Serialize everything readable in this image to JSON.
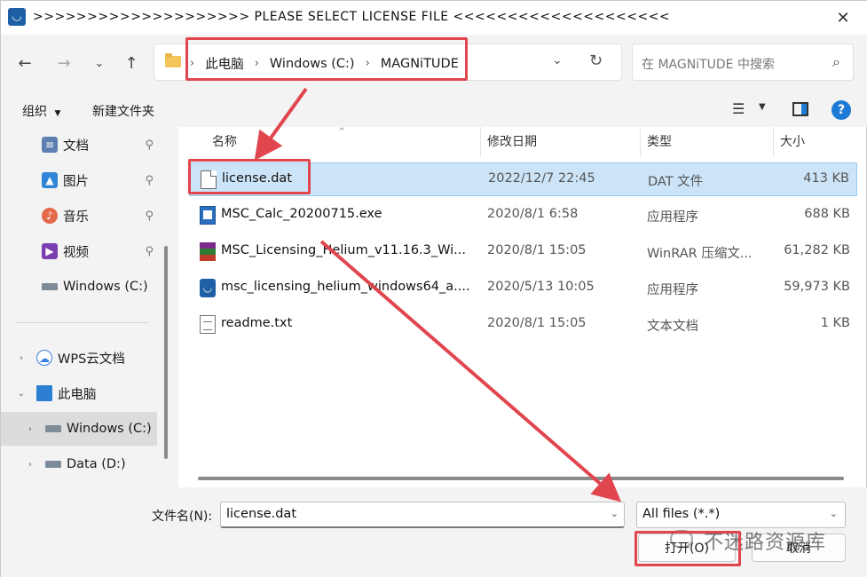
{
  "window": {
    "title": ">>>>>>>>>>>>>>>>>>>>  PLEASE SELECT LICENSE FILE  <<<<<<<<<<<<<<<<<<<<"
  },
  "nav": {
    "breadcrumbs": [
      "此电脑",
      "Windows (C:)",
      "MAGNiTUDE"
    ],
    "search_placeholder": "在 MAGNiTUDE 中搜索"
  },
  "commands": {
    "organize": "组织",
    "new_folder": "新建文件夹"
  },
  "sidebar": {
    "quick_access": [
      {
        "label": "文档",
        "icon": "document-icon",
        "color": "#5b7fb0"
      },
      {
        "label": "图片",
        "icon": "picture-icon",
        "color": "#2f86d6"
      },
      {
        "label": "音乐",
        "icon": "music-icon",
        "color": "#e5684b"
      },
      {
        "label": "视频",
        "icon": "video-icon",
        "color": "#7a3fb0"
      }
    ],
    "quick_drive": "Windows (C:)",
    "tree": [
      {
        "label": "WPS云文档",
        "icon": "cloud-icon"
      },
      {
        "label": "此电脑",
        "icon": "computer-icon"
      },
      {
        "label": "Windows (C:)",
        "icon": "drive-icon"
      },
      {
        "label": "Data (D:)",
        "icon": "drive-icon"
      }
    ]
  },
  "columns": {
    "name": "名称",
    "date": "修改日期",
    "type": "类型",
    "size": "大小"
  },
  "files": [
    {
      "name": "license.dat",
      "date": "2022/12/7 22:45",
      "type": "DAT 文件",
      "size": "413 KB",
      "icon": "file-icon"
    },
    {
      "name": "MSC_Calc_20200715.exe",
      "date": "2020/8/1 6:58",
      "type": "应用程序",
      "size": "688 KB",
      "icon": "exe-icon"
    },
    {
      "name": "MSC_Licensing_Helium_v11.16.3_Wi...",
      "date": "2020/8/1 15:05",
      "type": "WinRAR 压缩文...",
      "size": "61,282 KB",
      "icon": "archive-icon"
    },
    {
      "name": "msc_licensing_helium_windows64_a....",
      "date": "2020/5/13 10:05",
      "type": "应用程序",
      "size": "59,973 KB",
      "icon": "installer-icon"
    },
    {
      "name": "readme.txt",
      "date": "2020/8/1 15:05",
      "type": "文本文档",
      "size": "1 KB",
      "icon": "text-file-icon"
    }
  ],
  "bottom": {
    "filename_label": "文件名(N):",
    "filename_value": "license.dat",
    "filter_value": "All files (*.*)",
    "open_label": "打开(O)",
    "cancel_label": "取消"
  },
  "watermark": "不迷路资源库",
  "accent": "#e1464f"
}
